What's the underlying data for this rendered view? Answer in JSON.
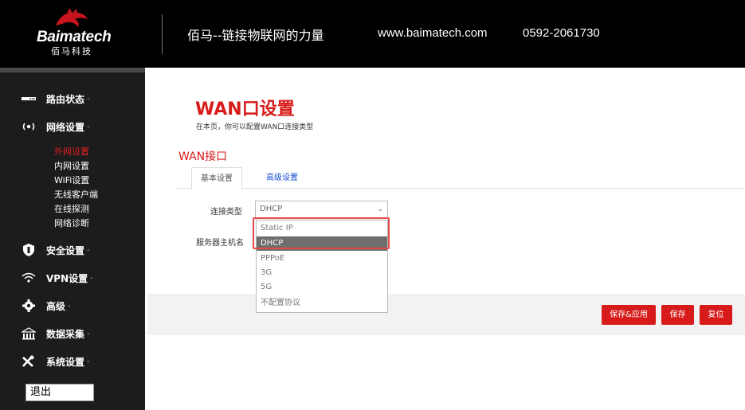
{
  "header": {
    "brand_name": "Baimatech",
    "brand_sub": "佰马科技",
    "slogan": "佰马--链接物联网的力量",
    "website": "www.baimatech.com",
    "phone": "0592-2061730"
  },
  "sidebar": {
    "items": [
      {
        "label": "路由状态",
        "icon": "router-status-icon"
      },
      {
        "label": "网络设置",
        "icon": "network-icon"
      },
      {
        "label": "安全设置",
        "icon": "shield-icon"
      },
      {
        "label": "VPN设置",
        "icon": "vpn-icon"
      },
      {
        "label": "高级",
        "icon": "gear-icon"
      },
      {
        "label": "数据采集",
        "icon": "data-collect-icon"
      },
      {
        "label": "系统设置",
        "icon": "tools-icon"
      }
    ],
    "caret": "-",
    "subitems": [
      "外网设置",
      "内网设置",
      "WiFi设置",
      "无线客户端",
      "在线探测",
      "网络诊断"
    ],
    "active_subitem": "外网设置",
    "logout_label": "退出"
  },
  "main": {
    "title": "WAN口设置",
    "description": "在本页，你可以配置WAN口连接类型",
    "section_title": "WAN接口",
    "tabs": [
      {
        "label": "基本设置",
        "active": true
      },
      {
        "label": "高级设置",
        "active": false
      }
    ],
    "form": {
      "connection_type_label": "连接类型",
      "connection_type_value": "DHCP",
      "hostname_label": "服务器主机名"
    },
    "dropdown_options": [
      "Static IP",
      "DHCP",
      "PPPoE",
      "3G",
      "5G",
      "不配置协议"
    ],
    "dropdown_selected": "DHCP",
    "buttons": {
      "save_apply": "保存&应用",
      "save": "保存",
      "reset": "复位"
    }
  },
  "colors": {
    "accent": "#d71a1a",
    "sidebar_bg": "#1c1c1c",
    "topbar_bg": "#000000",
    "link": "#1a4fd6",
    "highlight_box": "#e74848"
  }
}
